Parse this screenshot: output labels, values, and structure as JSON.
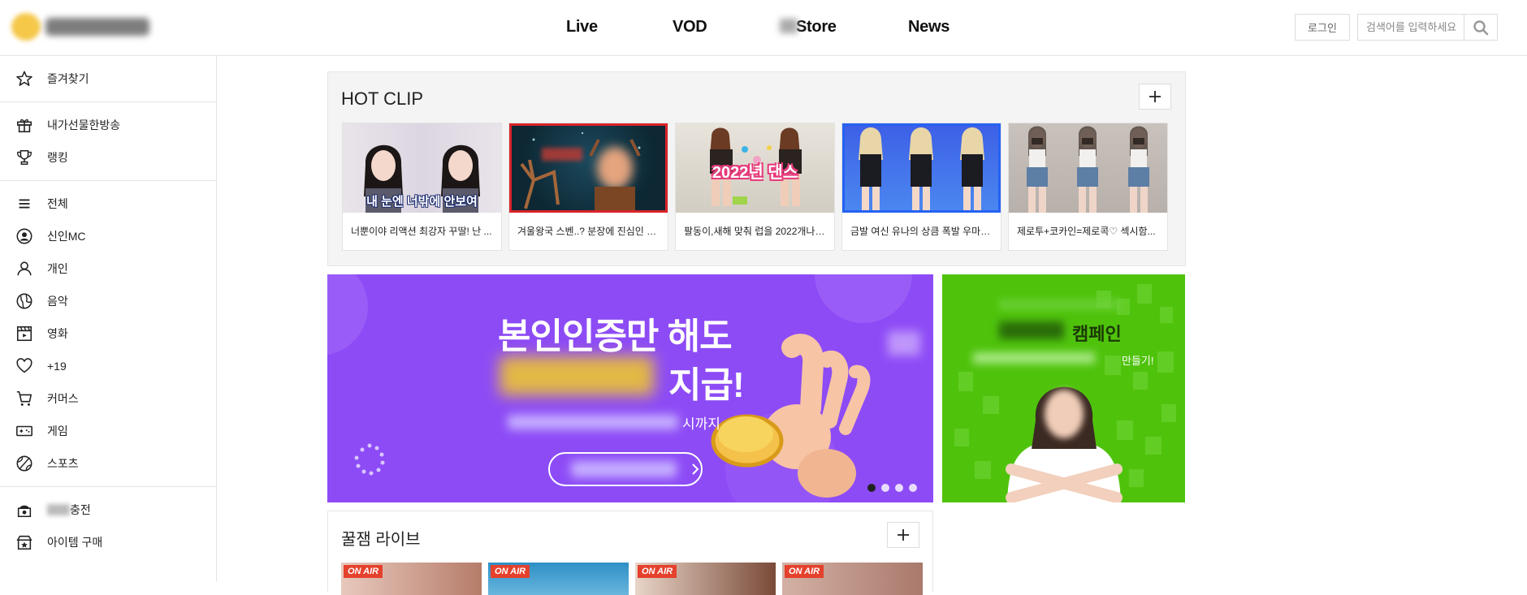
{
  "header": {
    "nav": [
      {
        "label": "Live"
      },
      {
        "label": "VOD"
      },
      {
        "label": "Store"
      },
      {
        "label": "News"
      }
    ],
    "login_label": "로그인",
    "search_placeholder": "검색어를 입력하세요"
  },
  "sidebar": {
    "groups": [
      [
        {
          "label": "즐겨찾기",
          "icon": "star-icon"
        }
      ],
      [
        {
          "label": "내가선물한방송",
          "icon": "gift-icon"
        },
        {
          "label": "랭킹",
          "icon": "trophy-icon"
        }
      ],
      [
        {
          "label": "전체",
          "icon": "menu-icon"
        },
        {
          "label": "신인MC",
          "icon": "new-user-icon"
        },
        {
          "label": "개인",
          "icon": "user-icon"
        },
        {
          "label": "음악",
          "icon": "music-globe-icon"
        },
        {
          "label": "영화",
          "icon": "clapperboard-icon"
        },
        {
          "label": "+19",
          "icon": "heart-icon"
        },
        {
          "label": "커머스",
          "icon": "cart-icon"
        },
        {
          "label": "게임",
          "icon": "gamepad-icon"
        },
        {
          "label": "스포츠",
          "icon": "ball-icon"
        }
      ],
      [
        {
          "label": "충전",
          "icon": "charge-icon"
        },
        {
          "label": "아이템 구매",
          "icon": "item-icon"
        }
      ]
    ]
  },
  "hot_clip": {
    "title": "HOT CLIP",
    "clips": [
      {
        "caption": "너뿐이야 리액션 최강자 꾸딸! 난 ...",
        "overlay": "내 눈엔 너밖에 안보여"
      },
      {
        "caption": "겨울왕국 스벤..? 분장에 진심인 친..."
      },
      {
        "caption": "팔동이,새해 맞춰 럽을 2022개나?!??",
        "overlay": "2022년 댄스"
      },
      {
        "caption": "금발 여신 유나의 상큼 폭발 우마우..."
      },
      {
        "caption": "제로투+코카인=제로콕♡ 섹시함..."
      }
    ]
  },
  "banner_main": {
    "line1": "본인인증만 해도",
    "line2_suffix": "지급!",
    "date_suffix": "시까지"
  },
  "banner_side": {
    "title": "캠페인",
    "subtitle": "만들기!"
  },
  "live": {
    "title": "꿀잼 라이브",
    "badge": "ON AIR",
    "cards": 4
  },
  "colors": {
    "purple": "#8d4bf6",
    "green": "#4fc30c",
    "onair": "#e5412d"
  }
}
